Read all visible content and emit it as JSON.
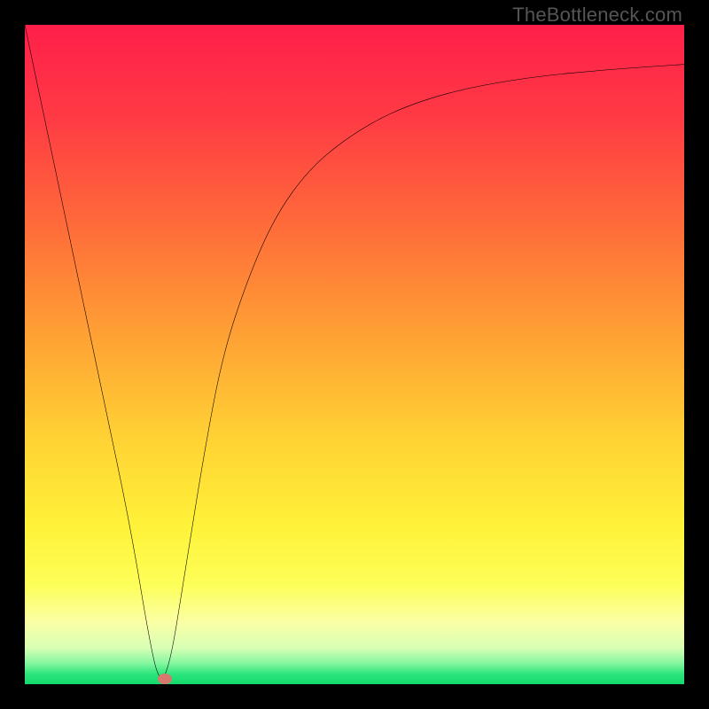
{
  "watermark": "TheBottleneck.com",
  "chart_data": {
    "type": "line",
    "title": "",
    "xlabel": "",
    "ylabel": "",
    "xlim": [
      0,
      100
    ],
    "ylim": [
      0,
      100
    ],
    "grid": false,
    "legend": false,
    "series": [
      {
        "name": "bottleneck-curve",
        "x": [
          0,
          8,
          12,
          16,
          19,
          20.5,
          22,
          24,
          27,
          30,
          34,
          38,
          43,
          49,
          56,
          65,
          76,
          88,
          100
        ],
        "values": [
          100,
          62,
          43,
          24,
          6,
          0,
          3,
          15,
          34,
          50,
          62,
          71,
          78,
          83,
          87,
          90,
          92,
          93.2,
          94
        ]
      }
    ],
    "marker": {
      "x": 21.2,
      "y": 0.8,
      "color": "#d8776e"
    },
    "background_gradient": {
      "stops": [
        {
          "pos": 0.0,
          "color": "#ff1f4a"
        },
        {
          "pos": 0.14,
          "color": "#ff3a44"
        },
        {
          "pos": 0.3,
          "color": "#ff6a3a"
        },
        {
          "pos": 0.48,
          "color": "#ffa434"
        },
        {
          "pos": 0.63,
          "color": "#ffd334"
        },
        {
          "pos": 0.76,
          "color": "#fff238"
        },
        {
          "pos": 0.85,
          "color": "#fdff59"
        },
        {
          "pos": 0.905,
          "color": "#fbffa4"
        },
        {
          "pos": 0.945,
          "color": "#d8ffb5"
        },
        {
          "pos": 0.968,
          "color": "#86f7a0"
        },
        {
          "pos": 0.985,
          "color": "#2ae57a"
        },
        {
          "pos": 1.0,
          "color": "#14da6c"
        }
      ]
    }
  }
}
